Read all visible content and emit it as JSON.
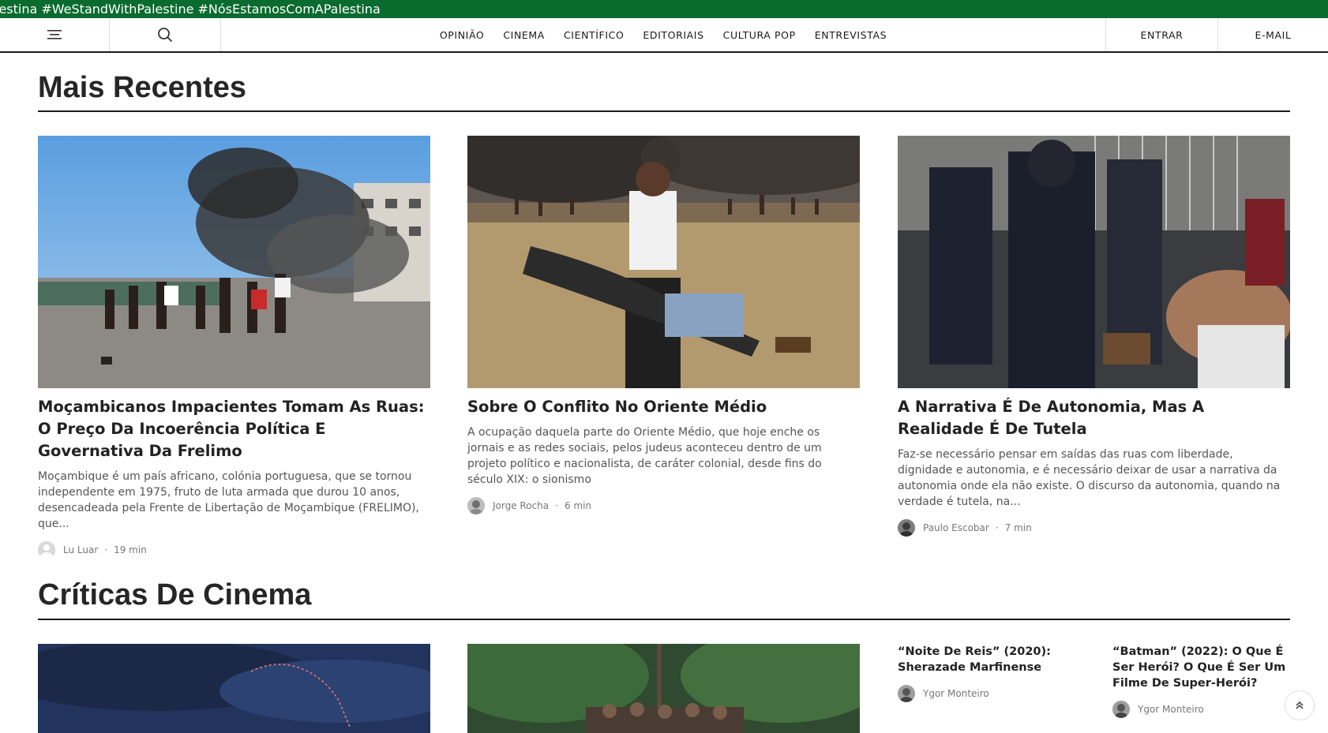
{
  "ticker": {
    "text": "lestina #WeStandWithPalestine #NósEstamosComAPalestina"
  },
  "nav": {
    "links": [
      "OPINIÃO",
      "CINEMA",
      "CIENTÍFICO",
      "EDITORIAIS",
      "CULTURA POP",
      "ENTREVISTAS"
    ],
    "login": "ENTRAR",
    "email": "E-MAIL"
  },
  "recent": {
    "title": "Mais Recentes",
    "articles": [
      {
        "title": "Moçambicanos Impacientes Tomam As Ruas: O Preço Da Incoerência Política E Governativa Da Frelimo",
        "excerpt": "Moçambique é um país africano, colónia portuguesa, que se tornou independente em 1975, fruto de luta armada que durou 10 anos, desencadeada pela Frente de Libertação de Moçambique (FRELIMO), que...",
        "author": "Lu Luar",
        "time": "19 min"
      },
      {
        "title": "Sobre O Conflito No Oriente Médio",
        "excerpt": "A ocupação daquela parte do Oriente Médio, que hoje enche os jornais e as redes sociais, pelos judeus aconteceu dentro de um projeto político e nacionalista, de caráter colonial, desde fins do século XIX: o sionismo",
        "author": "Jorge Rocha",
        "time": "6 min"
      },
      {
        "title": "A Narrativa É De Autonomia, Mas A Realidade É De Tutela",
        "excerpt": "Faz-se necessário pensar em saídas das ruas com liberdade, dignidade e autonomia, e é necessário deixar de usar a narrativa da autonomia onde ela não existe. O discurso da autonomia, quando na verdade é tutela, na...",
        "author": "Paulo Escobar",
        "time": "7 min"
      }
    ]
  },
  "cinema": {
    "title": "Críticas De Cinema",
    "side": [
      {
        "title": "“Noite De Reis” (2020): Sherazade Marfinense",
        "author": "Ygor Monteiro"
      },
      {
        "title": "“Batman” (2022): O Que É Ser Herói? O Que É Ser Um Filme De Super-Herói?",
        "author": "Ygor Monteiro"
      }
    ]
  },
  "colors": {
    "ticker_bg": "#0a6b2e",
    "text": "#1a1a1a"
  },
  "icons": {
    "menu": "hamburger-icon",
    "search": "search-icon",
    "scroll_top": "chevron-double-up-icon"
  }
}
